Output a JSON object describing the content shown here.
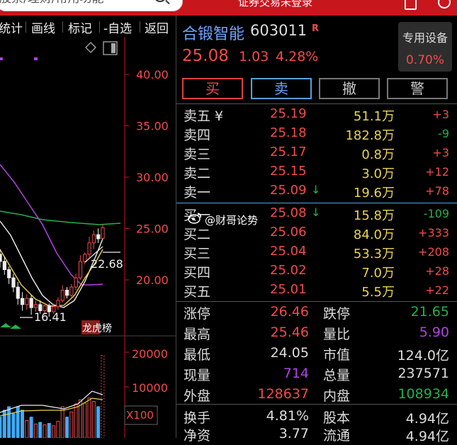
{
  "colors": {
    "up": "#f24b4b",
    "down": "#22b14c",
    "volume": "#e8d44d",
    "accent_blue": "#6fa3ff",
    "purple": "#b043e0",
    "topbar": "#c8161d"
  },
  "topbar": {
    "search_text": "股票/理财/常用功能",
    "login_text": "证券交易未登录"
  },
  "toolbar": {
    "items": [
      "统计",
      "画线",
      "标记",
      "-自选",
      "返回"
    ]
  },
  "chart": {
    "price_ticks": [
      "40.00",
      "35.00",
      "30.00",
      "25.00",
      "20.00"
    ],
    "high_marker": "22.68",
    "low_marker": "16.41",
    "badge": "龙虎榜",
    "volume_ticks": [
      "20000",
      "10000"
    ],
    "volume_unit": "X100"
  },
  "stock": {
    "name": "合锻智能",
    "code": "603011",
    "tag": "R",
    "price": "25.08",
    "change": "1.03",
    "change_pct": "4.28%",
    "special_label": "专用设备",
    "special_value": "0.70%"
  },
  "trade_buttons": [
    "买",
    "卖",
    "撤",
    "警"
  ],
  "order_book": {
    "sell": [
      {
        "label": "卖五 ¥",
        "price": "25.19",
        "vol": "51.1万",
        "chg": "+3"
      },
      {
        "label": "卖四",
        "price": "25.18",
        "vol": "182.8万",
        "chg": "-9"
      },
      {
        "label": "卖三",
        "price": "25.17",
        "vol": "0.8万",
        "chg": "+3"
      },
      {
        "label": "卖二",
        "price": "25.15",
        "vol": "3.0万",
        "chg": "+12"
      },
      {
        "label": "卖一",
        "price": "25.09",
        "vol": "19.6万",
        "chg": "+78"
      }
    ],
    "buy": [
      {
        "label": "买一",
        "price": "25.08",
        "vol": "15.8万",
        "chg": "-109"
      },
      {
        "label": "买二",
        "price": "25.06",
        "vol": "84.0万",
        "chg": "+333"
      },
      {
        "label": "买三",
        "price": "25.04",
        "vol": "53.3万",
        "chg": "+208"
      },
      {
        "label": "买四",
        "price": "25.02",
        "vol": "7.0万",
        "chg": "+28"
      },
      {
        "label": "买五",
        "price": "25.01",
        "vol": "5.5万",
        "chg": "+22"
      }
    ]
  },
  "stats": [
    {
      "label": "涨停",
      "value": "26.46"
    },
    {
      "label": "跌停",
      "value": "21.65"
    },
    {
      "label": "最高",
      "value": "25.46"
    },
    {
      "label": "量比",
      "value": "5.90"
    },
    {
      "label": "最低",
      "value": "24.05"
    },
    {
      "label": "市值",
      "value": "124.0亿"
    },
    {
      "label": "现量",
      "value": "714"
    },
    {
      "label": "总量",
      "value": "237571"
    },
    {
      "label": "外盘",
      "value": "128637"
    },
    {
      "label": "内盘",
      "value": "108934"
    },
    {
      "label": "换手",
      "value": "4.81%"
    },
    {
      "label": "股本",
      "value": "4.94亿"
    },
    {
      "label": "净资",
      "value": "3.77"
    },
    {
      "label": "流通",
      "value": "4.94亿"
    }
  ],
  "watermark": "@财哥论势",
  "candles": [
    {
      "o": 22.5,
      "c": 21.8,
      "h": 23.0,
      "l": 21.2,
      "v": 6000
    },
    {
      "o": 21.8,
      "c": 21.0,
      "h": 22.3,
      "l": 20.5,
      "v": 8000
    },
    {
      "o": 21.0,
      "c": 20.2,
      "h": 21.3,
      "l": 19.6,
      "v": 9000
    },
    {
      "o": 20.2,
      "c": 19.3,
      "h": 20.6,
      "l": 18.8,
      "v": 7000
    },
    {
      "o": 19.3,
      "c": 18.2,
      "h": 19.8,
      "l": 17.6,
      "v": 9000
    },
    {
      "o": 18.2,
      "c": 17.6,
      "h": 18.8,
      "l": 17.0,
      "v": 8000
    },
    {
      "o": 17.6,
      "c": 18.2,
      "h": 18.6,
      "l": 17.1,
      "v": 5000
    },
    {
      "o": 18.2,
      "c": 17.3,
      "h": 18.5,
      "l": 16.6,
      "v": 6000
    },
    {
      "o": 17.3,
      "c": 17.6,
      "h": 18.0,
      "l": 16.9,
      "v": 4000
    },
    {
      "o": 17.6,
      "c": 17.0,
      "h": 18.0,
      "l": 16.7,
      "v": 4500
    },
    {
      "o": 17.0,
      "c": 17.5,
      "h": 17.8,
      "l": 16.6,
      "v": 3800
    },
    {
      "o": 17.5,
      "c": 16.9,
      "h": 17.7,
      "l": 16.41,
      "v": 4200
    },
    {
      "o": 16.9,
      "c": 17.4,
      "h": 17.7,
      "l": 16.7,
      "v": 3500
    },
    {
      "o": 17.4,
      "c": 18.0,
      "h": 18.3,
      "l": 17.1,
      "v": 4800
    },
    {
      "o": 18.0,
      "c": 19.0,
      "h": 19.5,
      "l": 17.8,
      "v": 9000
    },
    {
      "o": 19.0,
      "c": 18.5,
      "h": 19.3,
      "l": 18.2,
      "v": 6000
    },
    {
      "o": 18.5,
      "c": 19.3,
      "h": 19.6,
      "l": 18.3,
      "v": 7500
    },
    {
      "o": 19.3,
      "c": 20.2,
      "h": 20.6,
      "l": 19.0,
      "v": 9800
    },
    {
      "o": 20.2,
      "c": 21.8,
      "h": 22.4,
      "l": 20.0,
      "v": 11000
    },
    {
      "o": 21.8,
      "c": 22.5,
      "h": 22.68,
      "l": 21.5,
      "v": 10000
    },
    {
      "o": 22.5,
      "c": 23.6,
      "h": 24.2,
      "l": 22.2,
      "v": 11500
    },
    {
      "o": 23.6,
      "c": 24.4,
      "h": 24.8,
      "l": 23.0,
      "v": 10500
    },
    {
      "o": 24.4,
      "c": 24.0,
      "h": 25.0,
      "l": 23.6,
      "v": 9000
    },
    {
      "o": 24.05,
      "c": 25.08,
      "h": 25.46,
      "l": 24.05,
      "v": 23757
    }
  ]
}
